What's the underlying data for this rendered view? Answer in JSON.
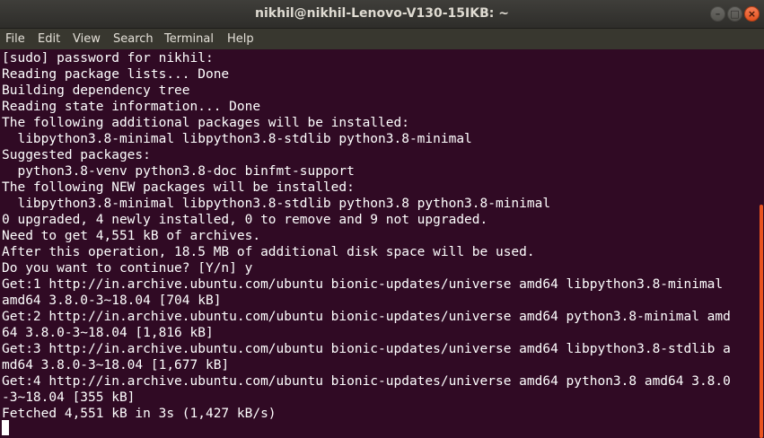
{
  "window": {
    "title": "nikhil@nikhil-Lenovo-V130-15IKB: ~",
    "buttons": {
      "minimize": "–",
      "maximize": "□",
      "close": "×"
    }
  },
  "menu": {
    "items": [
      "File",
      "Edit",
      "View",
      "Search",
      "Terminal",
      "Help"
    ]
  },
  "terminal": {
    "lines": [
      "[sudo] password for nikhil:",
      "Reading package lists... Done",
      "Building dependency tree",
      "Reading state information... Done",
      "The following additional packages will be installed:",
      "  libpython3.8-minimal libpython3.8-stdlib python3.8-minimal",
      "Suggested packages:",
      "  python3.8-venv python3.8-doc binfmt-support",
      "The following NEW packages will be installed:",
      "  libpython3.8-minimal libpython3.8-stdlib python3.8 python3.8-minimal",
      "0 upgraded, 4 newly installed, 0 to remove and 9 not upgraded.",
      "Need to get 4,551 kB of archives.",
      "After this operation, 18.5 MB of additional disk space will be used.",
      "Do you want to continue? [Y/n] y",
      "Get:1 http://in.archive.ubuntu.com/ubuntu bionic-updates/universe amd64 libpython3.8-minimal",
      "amd64 3.8.0-3~18.04 [704 kB]",
      "Get:2 http://in.archive.ubuntu.com/ubuntu bionic-updates/universe amd64 python3.8-minimal amd",
      "64 3.8.0-3~18.04 [1,816 kB]",
      "Get:3 http://in.archive.ubuntu.com/ubuntu bionic-updates/universe amd64 libpython3.8-stdlib a",
      "md64 3.8.0-3~18.04 [1,677 kB]",
      "Get:4 http://in.archive.ubuntu.com/ubuntu bionic-updates/universe amd64 python3.8 amd64 3.8.0",
      "-3~18.04 [355 kB]",
      "Fetched 4,551 kB in 3s (1,427 kB/s)"
    ]
  },
  "colors": {
    "terminal_background": "#300a24",
    "terminal_text": "#ffffff",
    "scrollbar_thumb": "#e95420"
  }
}
